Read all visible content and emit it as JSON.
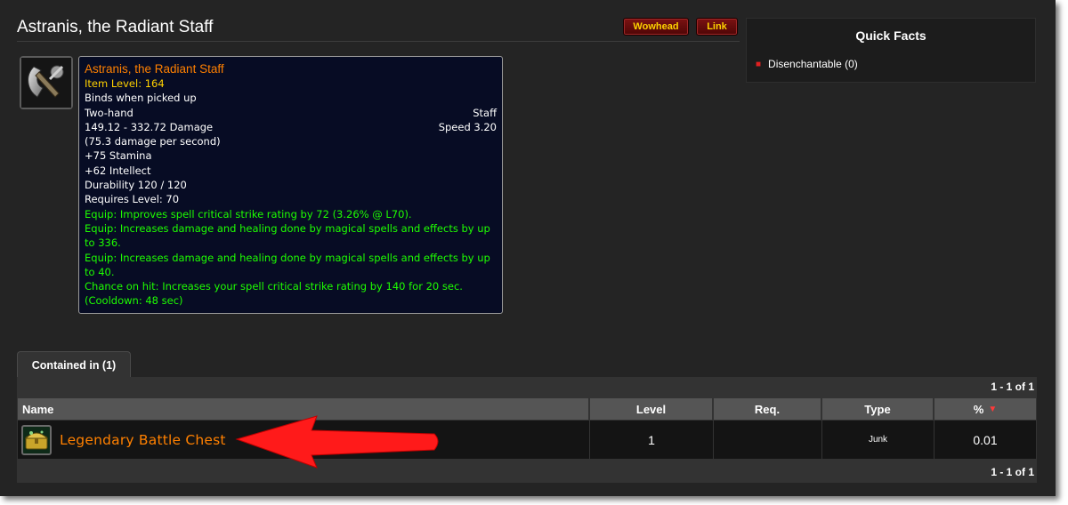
{
  "page": {
    "title": "Astranis, the Radiant Staff",
    "buttons": {
      "wowhead": "Wowhead",
      "link": "Link"
    }
  },
  "quick_facts": {
    "title": "Quick Facts",
    "items": [
      "Disenchantable (0)"
    ]
  },
  "icons": {
    "item": "staff-icon",
    "chest": "treasure-chest-icon",
    "sort": "sort-descending-icon",
    "annotation": "red-arrow"
  },
  "tooltip": {
    "name": "Astranis, the Radiant Staff",
    "item_level": "Item Level: 164",
    "binds": "Binds when picked up",
    "slot": "Two-hand",
    "subtype": "Staff",
    "damage": "149.12 - 332.72 Damage",
    "speed": "Speed 3.20",
    "dps": "(75.3 damage per second)",
    "stamina": "+75 Stamina",
    "intellect": "+62 Intellect",
    "durability": "Durability 120 / 120",
    "requires": "Requires Level: 70",
    "equip1": "Equip: Improves spell critical strike rating by 72 (3.26% @ L70).",
    "equip2": "Equip: Increases damage and healing done by magical spells and effects by up to 336.",
    "equip3": "Equip: Increases damage and healing done by magical spells and effects by up to 40.",
    "chance": "Chance on hit: Increases your spell critical strike rating by 140 for 20 sec. (Cooldown: 48 sec)"
  },
  "contained": {
    "tab_label": "Contained in (1)",
    "pager": "1 - 1 of 1",
    "columns": {
      "name": "Name",
      "level": "Level",
      "req": "Req.",
      "type": "Type",
      "pct": "%"
    },
    "rows": [
      {
        "name": "Legendary Battle Chest",
        "level": "1",
        "req": "",
        "type": "Junk",
        "pct": "0.01"
      }
    ]
  },
  "colors": {
    "legendary": "#ff8000",
    "item_level": "#ffd100",
    "equip": "#1eff00",
    "tooltip_bg": "#070c24",
    "button_text": "#ffd200",
    "annotation": "#ff1a1a"
  }
}
